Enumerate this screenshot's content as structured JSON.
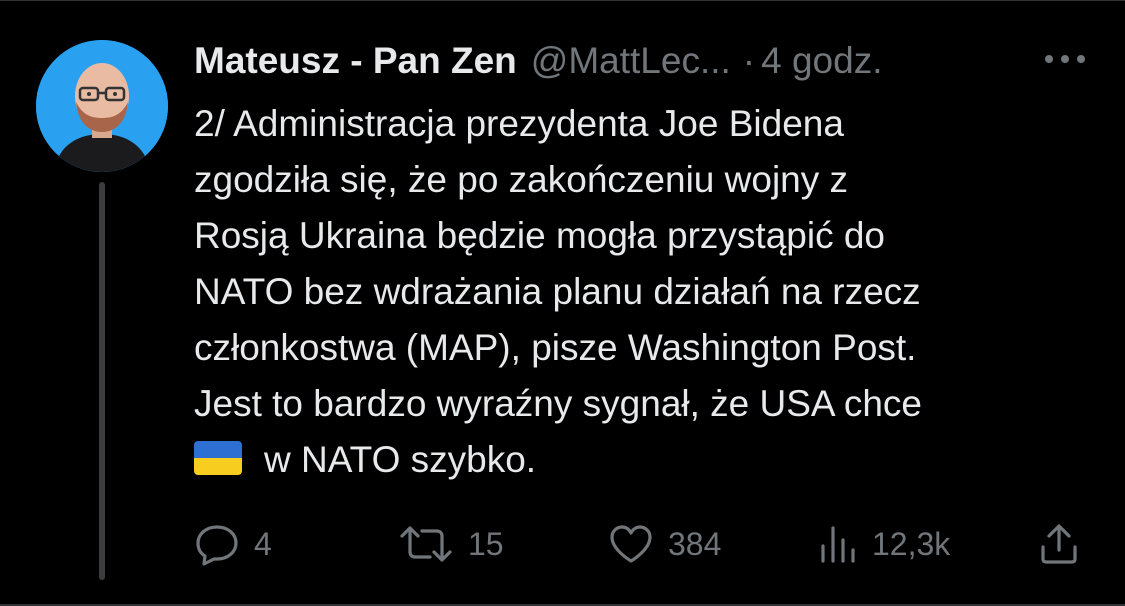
{
  "tweet": {
    "author": {
      "display_name": "Mateusz - Pan Zen",
      "handle": "@MattLec...",
      "avatar_icon": "profile-photo"
    },
    "separator": "·",
    "time": "4 godz.",
    "more_icon": "more-horizontal-icon",
    "text_lines": [
      "2/ Administracja prezydenta Joe Bidena",
      "zgodziła się, że po zakończeniu wojny z",
      "Rosją Ukraina będzie mogła przystąpić do",
      "NATO bez wdrażania planu działań na rzecz",
      "członkostwa (MAP), pisze Washington  Post.",
      "Jest to bardzo wyraźny sygnał, że USA chce"
    ],
    "last_line": {
      "emoji": "ukraine-flag",
      "text": "w NATO szybko."
    },
    "actions": {
      "reply": {
        "icon": "reply-icon",
        "count": "4"
      },
      "retweet": {
        "icon": "retweet-icon",
        "count": "15"
      },
      "like": {
        "icon": "heart-icon",
        "count": "384"
      },
      "views": {
        "icon": "views-chart-icon",
        "count": "12,3k"
      },
      "share": {
        "icon": "share-icon"
      }
    }
  },
  "colors": {
    "background": "#000000",
    "primary_text": "#e7e9ea",
    "secondary_text": "#71767b",
    "avatar_bg": "#2aa0f0",
    "divider": "#2f3336",
    "flag_blue": "#2e6fd4",
    "flag_yellow": "#f7cd1f"
  }
}
